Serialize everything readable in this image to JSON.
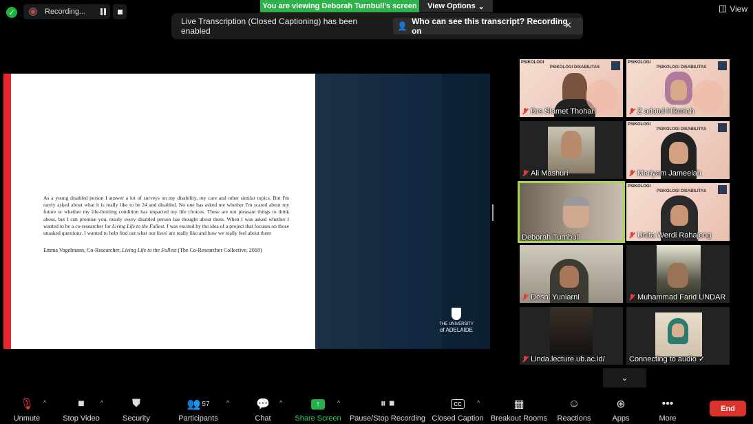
{
  "recording": {
    "label": "Recording..."
  },
  "banner": {
    "viewing": "You are viewing Deborah Turnbull's screen",
    "view_options": "View Options",
    "view": "View"
  },
  "toast": {
    "message": "Live Transcription (Closed Captioning) has been enabled",
    "who_can_see": "Who can see this transcript? Recording on",
    "close": "✕"
  },
  "slide": {
    "quote_p1": "As a young disabled person I answer a lot of surveys on my disability, my care and other similar topics. But I'm rarely asked about what it is really like to be 24 and disabled. No one has asked me whether I'm scared about my future or whether my life-limiting condition has impacted my life choices. These are not pleasant things to think about, but I can promise you, nearly every disabled person has thought about them. When I was asked whether I wanted to be a co-researcher for ",
    "quote_em": "Living Life to the Fullest",
    "quote_p2": ", I was excited by the idea of a project that focuses on those unasked questions. I wanted to help find out what our lives' are really like and how we really feel about them",
    "attr_a": "Emma Vogelmann, Co-Researcher, ",
    "attr_em": "Living Life to the Fullest",
    "attr_b": " (The Co-Researcher Collective, 2018)",
    "uni_line1": "THE UNIVERSITY",
    "uni_line2": "of ADELAIDE"
  },
  "banner_tile": {
    "brand": "PSIKOLOGI",
    "title": "PSIKOLOGI DISABILITAS"
  },
  "participants": [
    {
      "name": "Drs Slamet Thohari"
    },
    {
      "name": "Z adatul Hikmiah"
    },
    {
      "name": "Ali Mashuri"
    },
    {
      "name": "Mariyam Jameelah"
    },
    {
      "name": "Deborah Turnbull"
    },
    {
      "name": "Unita Werdi Rahajeng"
    },
    {
      "name": "Desni Yuniarni"
    },
    {
      "name": "Muhammad Farid UNDAR"
    },
    {
      "name": "Linda.lecture.ub.ac.id/"
    },
    {
      "name": "Connecting to audio ✓"
    }
  ],
  "toolbar": {
    "unmute": "Unmute",
    "stop_video": "Stop Video",
    "security": "Security",
    "participants": "Participants",
    "participants_count": "57",
    "chat": "Chat",
    "share_screen": "Share Screen",
    "pause_stop_recording": "Pause/Stop Recording",
    "closed_caption": "Closed Caption",
    "breakout_rooms": "Breakout Rooms",
    "reactions": "Reactions",
    "apps": "Apps",
    "more": "More",
    "end": "End"
  },
  "colors": {
    "accent_green": "#2fb24c",
    "end_red": "#d9332c",
    "active_speaker": "#a6d84a"
  }
}
